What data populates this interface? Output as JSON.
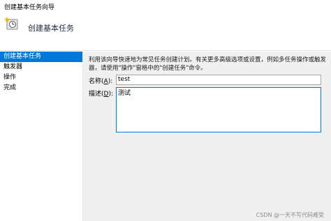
{
  "window": {
    "title": "创建基本任务向导"
  },
  "header": {
    "title": "创建基本任务",
    "icon": "task-wizard-icon"
  },
  "sidebar": {
    "items": [
      {
        "label": "创建基本任务",
        "active": true
      },
      {
        "label": "触发器",
        "active": false
      },
      {
        "label": "操作",
        "active": false
      },
      {
        "label": "完成",
        "active": false
      }
    ]
  },
  "main": {
    "description": "利用该向导快速地为常见任务创建计划。有关更多高级选项或设置，例如多任务操作或触发器，请使用\"操作\"窗格中的\"创建任务\"命令。",
    "name_label": "名称(",
    "name_key": "A",
    "name_suffix": "):",
    "name_value": "test",
    "desc_label": "描述(",
    "desc_key": "D",
    "desc_suffix": "):",
    "desc_value": "测试"
  },
  "watermark": "CSDN @一天不写代码难受",
  "colors": {
    "accent": "#0078d7",
    "panel": "#f0f0f0"
  }
}
